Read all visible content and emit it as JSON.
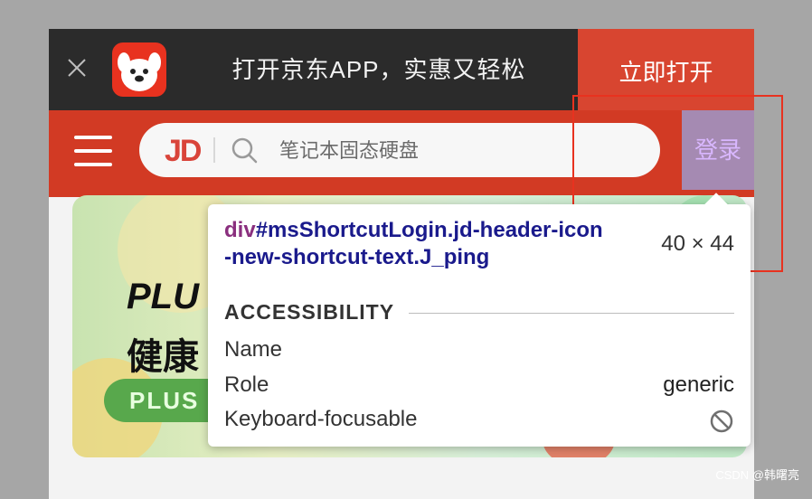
{
  "app_banner": {
    "text": "打开京东APP，实惠又轻松",
    "open_label": "立即打开",
    "close_icon": "close-icon",
    "logo_icon": "jd-dog-logo-icon"
  },
  "header": {
    "menu_icon": "hamburger-menu-icon",
    "brand_mark": "JD",
    "search_placeholder": "笔记本固态硬盘",
    "login_label": "登录"
  },
  "hero": {
    "line1": "PLU",
    "line2": "健康",
    "pill": "PLUS"
  },
  "inspector_tooltip": {
    "selector_tag": "div",
    "selector_rest_1": "#msShortcutLogin.jd-header-icon",
    "selector_rest_2": "-new-shortcut-text.J_ping",
    "size": "40 × 44",
    "section_title": "ACCESSIBILITY",
    "rows": [
      {
        "label": "Name",
        "value": ""
      },
      {
        "label": "Role",
        "value": "generic"
      },
      {
        "label": "Keyboard-focusable",
        "value": ""
      }
    ],
    "focus_icon": "not-focusable-icon"
  },
  "colors": {
    "jd_red": "#d23a24",
    "highlight": "#e8321f",
    "selector_tag_color": "#8a2f7e",
    "selector_id_color": "#1a1a8c"
  },
  "watermark": "CSDN @韩曙亮"
}
